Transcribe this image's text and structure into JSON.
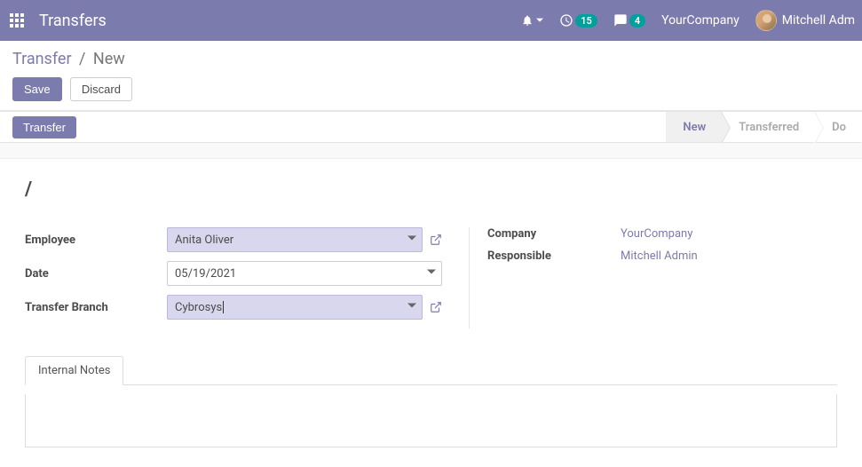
{
  "navbar": {
    "title": "Transfers",
    "clock_badge": "15",
    "chat_badge": "4",
    "company": "YourCompany",
    "user": "Mitchell Adm"
  },
  "breadcrumb": {
    "root": "Transfer",
    "current": "New"
  },
  "buttons": {
    "save": "Save",
    "discard": "Discard",
    "transfer": "Transfer"
  },
  "status": {
    "new": "New",
    "transferred": "Transferred",
    "done": "Do"
  },
  "title_text": "/",
  "fields": {
    "employee_label": "Employee",
    "employee_value": "Anita Oliver",
    "date_label": "Date",
    "date_value": "05/19/2021",
    "branch_label": "Transfer Branch",
    "branch_value": "Cybrosys",
    "company_label": "Company",
    "company_value": "YourCompany",
    "responsible_label": "Responsible",
    "responsible_value": "Mitchell Admin"
  },
  "tabs": {
    "internal_notes": "Internal Notes"
  }
}
